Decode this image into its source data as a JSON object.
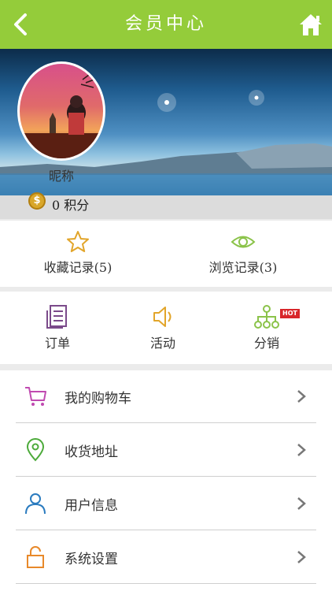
{
  "header": {
    "title": "会员中心",
    "back_icon": "chevron-left-icon",
    "home_icon": "home-icon",
    "bg_color": "#94cc3a"
  },
  "profile": {
    "nickname": "昵称",
    "points": "0 积分",
    "coin_symbol": "$"
  },
  "records": [
    {
      "label": "收藏记录(5)",
      "icon": "star-icon",
      "color": "#e2a52a"
    },
    {
      "label": "浏览记录(3)",
      "icon": "eye-icon",
      "color": "#8bc34a"
    }
  ],
  "actions": [
    {
      "label": "订单",
      "icon": "order-document-icon",
      "color": "#7b4a8a"
    },
    {
      "label": "活动",
      "icon": "speaker-icon",
      "color": "#e2a52a"
    },
    {
      "label": "分销",
      "icon": "distribution-tree-icon",
      "color": "#8bc34a",
      "badge": "HOT"
    }
  ],
  "menu": [
    {
      "label": "我的购物车",
      "icon": "shopping-cart-icon",
      "color": "#c04ab0"
    },
    {
      "label": "收货地址",
      "icon": "location-pin-icon",
      "color": "#4caa3a"
    },
    {
      "label": "用户信息",
      "icon": "user-icon",
      "color": "#2a7bbf"
    },
    {
      "label": "系统设置",
      "icon": "lock-icon",
      "color": "#e8892a"
    }
  ]
}
